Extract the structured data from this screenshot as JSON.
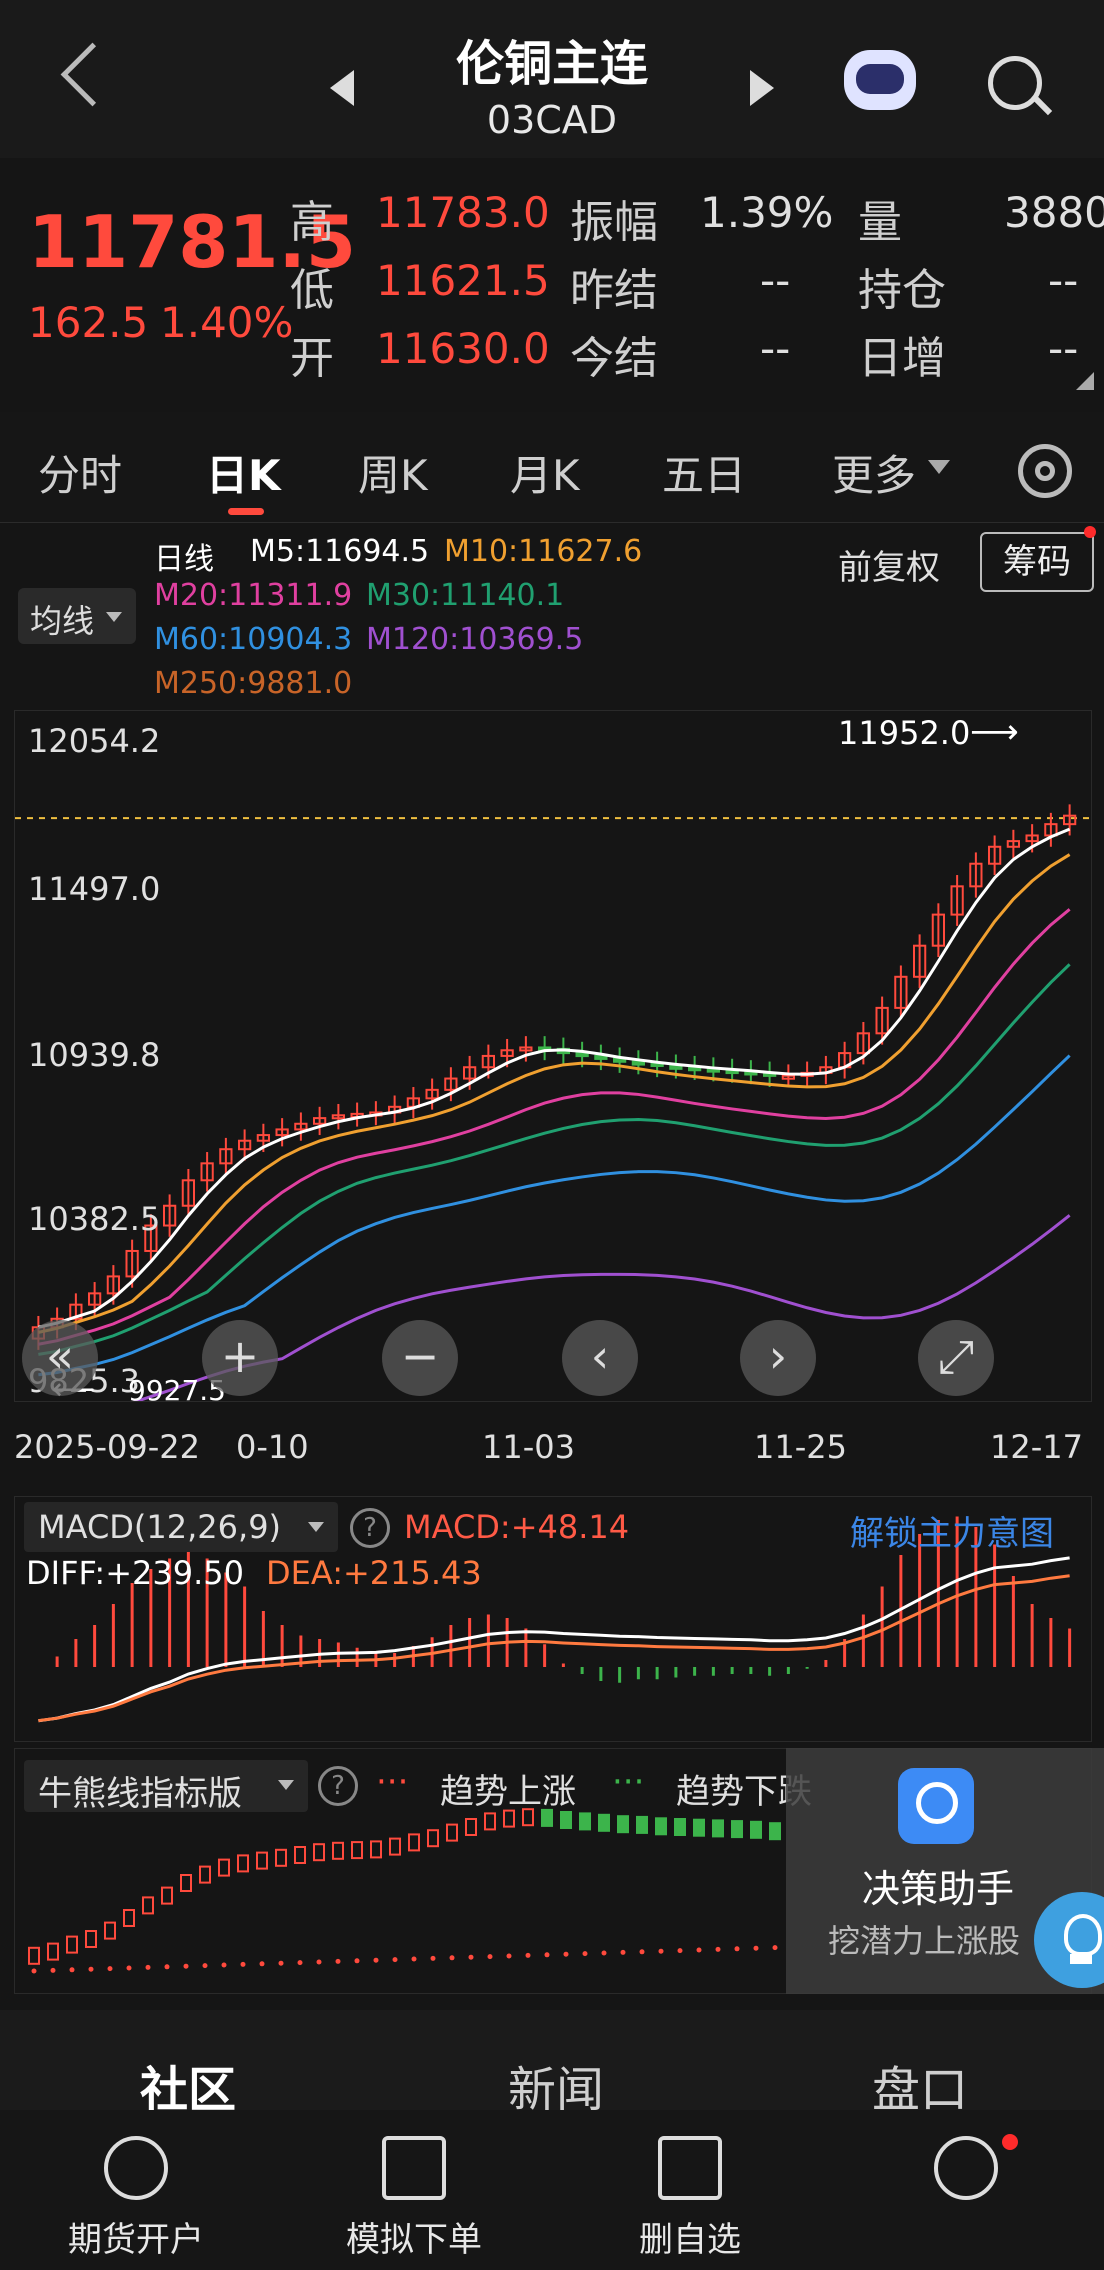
{
  "header": {
    "title": "伦铜主连",
    "code": "03CAD"
  },
  "quote": {
    "price": "11781.5",
    "change": "162.5",
    "change_pct": "1.40%",
    "high_label": "高",
    "high": "11783.0",
    "low_label": "低",
    "low": "11621.5",
    "open_label": "开",
    "open": "11630.0",
    "amp_label": "振幅",
    "amp": "1.39%",
    "prev_settle_label": "昨结",
    "prev_settle": "--",
    "settle_label": "今结",
    "settle": "--",
    "vol_label": "量",
    "vol": "3880",
    "oi_label": "持仓",
    "oi": "--",
    "daily_inc_label": "日增",
    "daily_inc": "--"
  },
  "tabs": [
    "分时",
    "日K",
    "周K",
    "月K",
    "五日",
    "更多"
  ],
  "legend": {
    "period": "日线",
    "ma_button": "均线",
    "adjust": "前复权",
    "chips_button": "筹码",
    "m5": "M5:11694.5",
    "m10": "M10:11627.6",
    "m20": "M20:11311.9",
    "m30": "M30:11140.1",
    "m60": "M60:10904.3",
    "m120": "M120:10369.5",
    "m250": "M250:9881.0"
  },
  "colors": {
    "up": "#ff4a3d",
    "down": "#3cb44b",
    "m5": "#ffffff",
    "m10": "#f0a030",
    "m20": "#e040a0",
    "m30": "#20a070",
    "m60": "#3090e0",
    "m120": "#a050d0",
    "m250": "#c86428"
  },
  "price_axis": [
    "12054.2",
    "11497.0",
    "10939.8",
    "10382.5",
    "9825.3"
  ],
  "date_axis": [
    "2025-09-22",
    "0-10",
    "11-03",
    "11-25",
    "12-17"
  ],
  "annotations": {
    "high": "11952.0",
    "low": "9927.5"
  },
  "chart_controls": [
    "rewind-icon",
    "zoom-in-icon",
    "zoom-out-icon",
    "prev-icon",
    "next-icon",
    "fullscreen-icon"
  ],
  "chart_data": {
    "type": "bar",
    "ylim": [
      9825.3,
      12054.2
    ],
    "series": [
      {
        "values": [
          9980,
          10010,
          10060,
          10100,
          10160,
          10250,
          10340,
          10410,
          10500,
          10560,
          10610,
          10640,
          10660,
          10680,
          10700,
          10720,
          10730,
          10735,
          10740,
          10760,
          10790,
          10820,
          10860,
          10900,
          10940,
          10960,
          10970,
          10965,
          10950,
          10940,
          10930,
          10920,
          10915,
          10905,
          10900,
          10895,
          10890,
          10885,
          10880,
          10870,
          10870,
          10880,
          10900,
          10950,
          11020,
          11110,
          11220,
          11330,
          11440,
          11540,
          11620,
          11680,
          11700,
          11720,
          11760,
          11790
        ]
      }
    ]
  },
  "macd": {
    "selector": "MACD(12,26,9)",
    "macd": "MACD:+48.14",
    "diff": "DIFF:+239.50",
    "dea": "DEA:+215.43",
    "unlock": "解锁主力意图"
  },
  "bull_bear": {
    "selector": "牛熊线指标版",
    "up_legend": "趋势上涨",
    "down_legend": "趋势下跌"
  },
  "assistant": {
    "title": "决策助手",
    "subtitle": "挖潜力上涨股"
  },
  "section_tabs": [
    "社区",
    "新闻",
    "盘口"
  ],
  "bottom_nav": [
    "期货开户",
    "模拟下单",
    "删自选",
    ""
  ]
}
